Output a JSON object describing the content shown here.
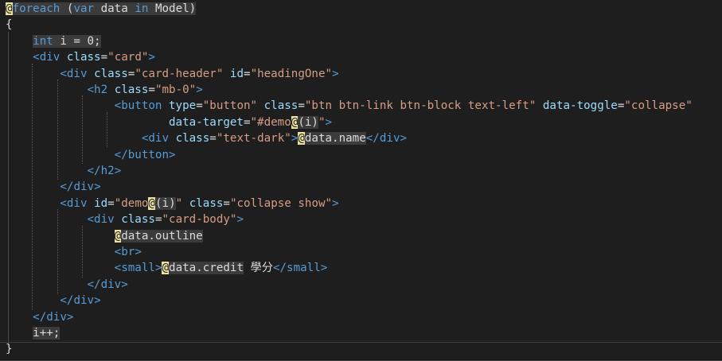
{
  "editor": {
    "language": "razor-cshtml",
    "lines": [
      [
        [
          "razor",
          "@"
        ],
        [
          "kw-hl",
          "foreach"
        ],
        [
          "hl",
          " ("
        ],
        [
          "kw-hl",
          "var"
        ],
        [
          "hl",
          " data "
        ],
        [
          "kw-hl",
          "in"
        ],
        [
          "hl",
          " Model)"
        ]
      ],
      [
        [
          "punct",
          "{"
        ]
      ],
      [
        [
          "sp",
          "    "
        ],
        [
          "kw-hl",
          "int"
        ],
        [
          "hl",
          " i = 0;"
        ]
      ],
      [
        [
          "sp",
          "    "
        ],
        [
          "bracket",
          "<"
        ],
        [
          "tag",
          "div"
        ],
        [
          "sp",
          " "
        ],
        [
          "attr",
          "class"
        ],
        [
          "punct",
          "="
        ],
        [
          "str",
          "\"card\""
        ],
        [
          "bracket",
          ">"
        ]
      ],
      [
        [
          "sp",
          "        "
        ],
        [
          "bracket",
          "<"
        ],
        [
          "tag",
          "div"
        ],
        [
          "sp",
          " "
        ],
        [
          "attr",
          "class"
        ],
        [
          "punct",
          "="
        ],
        [
          "str",
          "\"card-header\""
        ],
        [
          "sp",
          " "
        ],
        [
          "attr",
          "id"
        ],
        [
          "punct",
          "="
        ],
        [
          "str",
          "\"headingOne\""
        ],
        [
          "bracket",
          ">"
        ]
      ],
      [
        [
          "sp",
          "            "
        ],
        [
          "bracket",
          "<"
        ],
        [
          "tag",
          "h2"
        ],
        [
          "sp",
          " "
        ],
        [
          "attr",
          "class"
        ],
        [
          "punct",
          "="
        ],
        [
          "str",
          "\"mb-0\""
        ],
        [
          "bracket",
          ">"
        ]
      ],
      [
        [
          "sp",
          "                "
        ],
        [
          "bracket",
          "<"
        ],
        [
          "tag",
          "button"
        ],
        [
          "sp",
          " "
        ],
        [
          "attr",
          "type"
        ],
        [
          "punct",
          "="
        ],
        [
          "str",
          "\"button\""
        ],
        [
          "sp",
          " "
        ],
        [
          "attr",
          "class"
        ],
        [
          "punct",
          "="
        ],
        [
          "str",
          "\"btn btn-link btn-block text-left\""
        ],
        [
          "sp",
          " "
        ],
        [
          "attr",
          "data-toggle"
        ],
        [
          "punct",
          "="
        ],
        [
          "str",
          "\"collapse\""
        ]
      ],
      [
        [
          "sp",
          "                        "
        ],
        [
          "attr",
          "data-target"
        ],
        [
          "punct",
          "="
        ],
        [
          "str",
          "\"#demo"
        ],
        [
          "razor",
          "@"
        ],
        [
          "hl",
          "("
        ],
        [
          "hl",
          "i"
        ],
        [
          "hl",
          ")"
        ],
        [
          "str",
          "\""
        ],
        [
          "bracket",
          ">"
        ]
      ],
      [
        [
          "sp",
          "                    "
        ],
        [
          "bracket",
          "<"
        ],
        [
          "tag",
          "div"
        ],
        [
          "sp",
          " "
        ],
        [
          "attr",
          "class"
        ],
        [
          "punct",
          "="
        ],
        [
          "str",
          "\"text-dark\""
        ],
        [
          "bracket",
          ">"
        ],
        [
          "razor",
          "@"
        ],
        [
          "hl",
          "data.name"
        ],
        [
          "bracket",
          "</"
        ],
        [
          "tag",
          "div"
        ],
        [
          "bracket",
          ">"
        ]
      ],
      [
        [
          "sp",
          "                "
        ],
        [
          "bracket",
          "</"
        ],
        [
          "tag",
          "button"
        ],
        [
          "bracket",
          ">"
        ]
      ],
      [
        [
          "sp",
          "            "
        ],
        [
          "bracket",
          "</"
        ],
        [
          "tag",
          "h2"
        ],
        [
          "bracket",
          ">"
        ]
      ],
      [
        [
          "sp",
          "        "
        ],
        [
          "bracket",
          "</"
        ],
        [
          "tag",
          "div"
        ],
        [
          "bracket",
          ">"
        ]
      ],
      [
        [
          "sp",
          "        "
        ],
        [
          "bracket",
          "<"
        ],
        [
          "tag",
          "div"
        ],
        [
          "sp",
          " "
        ],
        [
          "attr",
          "id"
        ],
        [
          "punct",
          "="
        ],
        [
          "str",
          "\"demo"
        ],
        [
          "razor",
          "@"
        ],
        [
          "hl",
          "("
        ],
        [
          "hl",
          "i"
        ],
        [
          "hl",
          ")"
        ],
        [
          "str",
          "\""
        ],
        [
          "sp",
          " "
        ],
        [
          "attr",
          "class"
        ],
        [
          "punct",
          "="
        ],
        [
          "str",
          "\"collapse show\""
        ],
        [
          "bracket",
          ">"
        ]
      ],
      [
        [
          "sp",
          "            "
        ],
        [
          "bracket",
          "<"
        ],
        [
          "tag",
          "div"
        ],
        [
          "sp",
          " "
        ],
        [
          "attr",
          "class"
        ],
        [
          "punct",
          "="
        ],
        [
          "str",
          "\"card-body\""
        ],
        [
          "bracket",
          ">"
        ]
      ],
      [
        [
          "sp",
          "                "
        ],
        [
          "razor",
          "@"
        ],
        [
          "hl",
          "data.outline"
        ]
      ],
      [
        [
          "sp",
          "                "
        ],
        [
          "bracket",
          "<"
        ],
        [
          "tag",
          "br"
        ],
        [
          "bracket",
          ">"
        ]
      ],
      [
        [
          "sp",
          "                "
        ],
        [
          "bracket",
          "<"
        ],
        [
          "tag",
          "small"
        ],
        [
          "bracket",
          ">"
        ],
        [
          "razor",
          "@"
        ],
        [
          "hl",
          "data.credit"
        ],
        [
          "sp",
          " "
        ],
        [
          "cjk",
          "學分"
        ],
        [
          "bracket",
          "</"
        ],
        [
          "tag",
          "small"
        ],
        [
          "bracket",
          ">"
        ]
      ],
      [
        [
          "sp",
          "            "
        ],
        [
          "bracket",
          "</"
        ],
        [
          "tag",
          "div"
        ],
        [
          "bracket",
          ">"
        ]
      ],
      [
        [
          "sp",
          "        "
        ],
        [
          "bracket",
          "</"
        ],
        [
          "tag",
          "div"
        ],
        [
          "bracket",
          ">"
        ]
      ],
      [
        [
          "sp",
          "    "
        ],
        [
          "bracket",
          "</"
        ],
        [
          "tag",
          "div"
        ],
        [
          "bracket",
          ">"
        ]
      ],
      [
        [
          "sp",
          "    "
        ],
        [
          "hl",
          "i++;"
        ]
      ],
      [
        [
          "punct",
          "}"
        ]
      ]
    ]
  }
}
